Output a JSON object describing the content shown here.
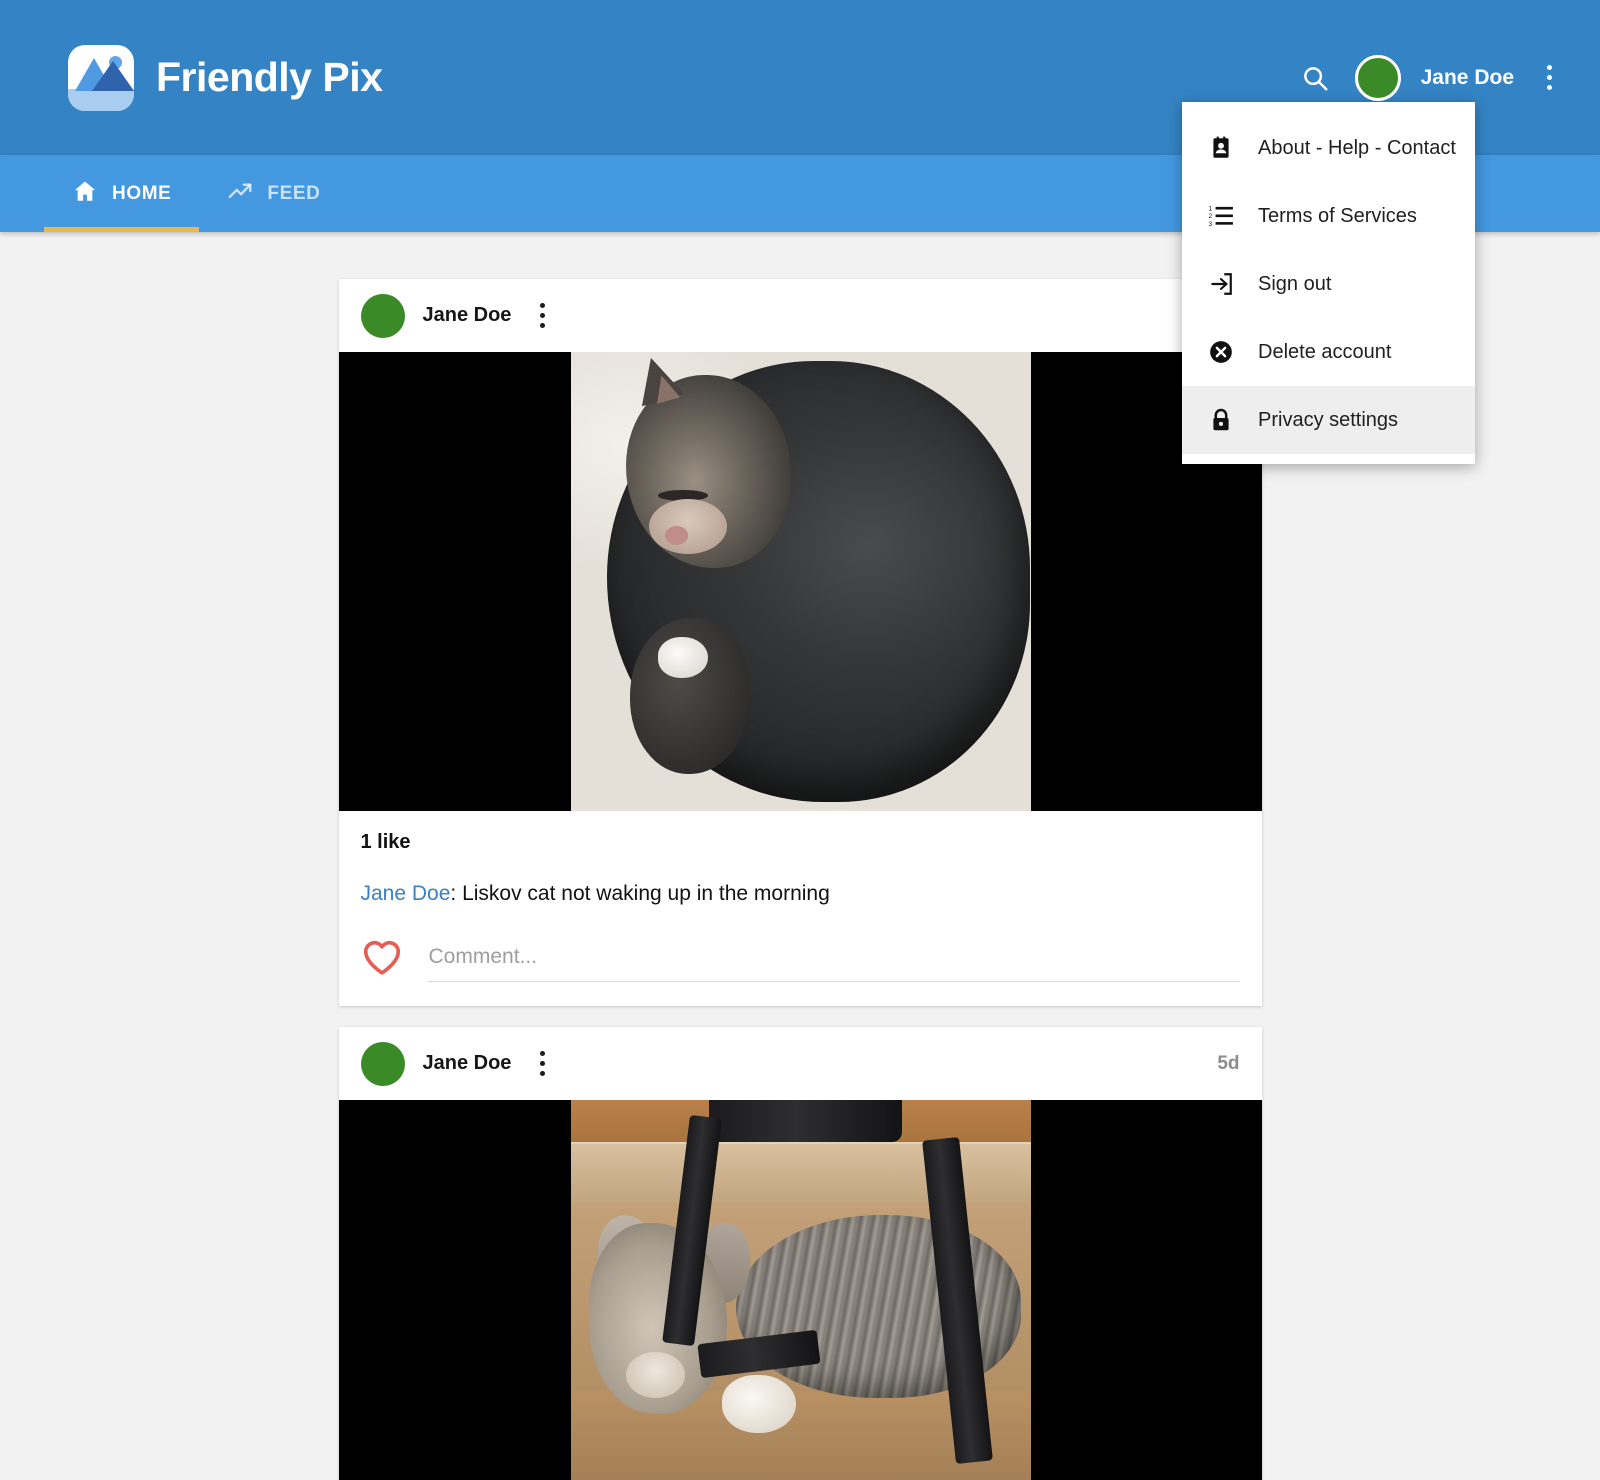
{
  "app": {
    "title": "Friendly Pix",
    "logo_icon": "photo-landscape-icon"
  },
  "header": {
    "search_icon": "search-icon",
    "user_name": "Jane Doe",
    "avatar_color": "#3a8a28",
    "overflow_icon": "vertical-dots-icon",
    "background": "#3484c5"
  },
  "nav": {
    "background": "#4398e0",
    "active_underline_color": "#e8b84b",
    "tabs": [
      {
        "label": "HOME",
        "icon": "home-icon",
        "active": true
      },
      {
        "label": "FEED",
        "icon": "trending-up-icon",
        "active": false
      }
    ]
  },
  "dropdown": {
    "open": true,
    "hover_background": "#eeeeee",
    "items": [
      {
        "label": "About - Help - Contact",
        "icon": "contact-card-icon",
        "hovered": false
      },
      {
        "label": "Terms of Services",
        "icon": "numbered-list-icon",
        "hovered": false
      },
      {
        "label": "Sign out",
        "icon": "sign-out-icon",
        "hovered": false
      },
      {
        "label": "Delete account",
        "icon": "x-circle-icon",
        "hovered": false
      },
      {
        "label": "Privacy settings",
        "icon": "lock-icon",
        "hovered": true
      }
    ]
  },
  "feed": {
    "posts": [
      {
        "author": "Jane Doe",
        "avatar_color": "#3a8a28",
        "overflow_icon": "vertical-dots-icon",
        "timestamp": "",
        "photo_alt": "Tabby cat curled up sleeping on white bedding",
        "like_count_label": "1 like",
        "caption_author": "Jane Doe",
        "caption_separator": ": ",
        "caption_text": "Liskov cat not waking up in the morning",
        "like_icon": "heart-outline-icon",
        "like_icon_color": "#e85c52",
        "comment_placeholder": "Comment...",
        "comment_value": ""
      },
      {
        "author": "Jane Doe",
        "avatar_color": "#3a8a28",
        "overflow_icon": "vertical-dots-icon",
        "timestamp": "5d",
        "photo_alt": "Tabby cat sleeping inside a cardboard box with black straps"
      }
    ]
  },
  "colors": {
    "page_background": "#f2f2f2",
    "card_background": "#ffffff",
    "link": "#3b7fc4"
  }
}
